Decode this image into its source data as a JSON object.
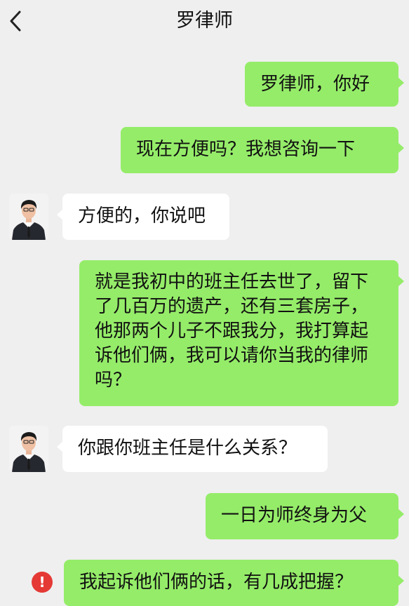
{
  "header": {
    "back_icon": "chevron-left-icon",
    "title": "罗律师"
  },
  "colors": {
    "background": "#efefef",
    "sent_bubble": "#95ec69",
    "received_bubble": "#ffffff",
    "error": "#e53935"
  },
  "messages": [
    {
      "sender": "me",
      "text": "罗律师，你好"
    },
    {
      "sender": "me",
      "text": "现在方便吗？我想咨询一下"
    },
    {
      "sender": "lawyer",
      "text": "方便的，你说吧"
    },
    {
      "sender": "me",
      "text": "就是我初中的班主任去世了，留下了几百万的遗产，还有三套房子，他那两个儿子不跟我分，我打算起诉他们俩，我可以请你当我的律师吗？"
    },
    {
      "sender": "lawyer",
      "text": "你跟你班主任是什么关系？"
    },
    {
      "sender": "me",
      "text": "一日为师终身为父"
    },
    {
      "sender": "me",
      "text": "我起诉他们俩的话，有几成把握？",
      "status_icon": "send-failed-icon",
      "status_glyph": "!"
    }
  ]
}
